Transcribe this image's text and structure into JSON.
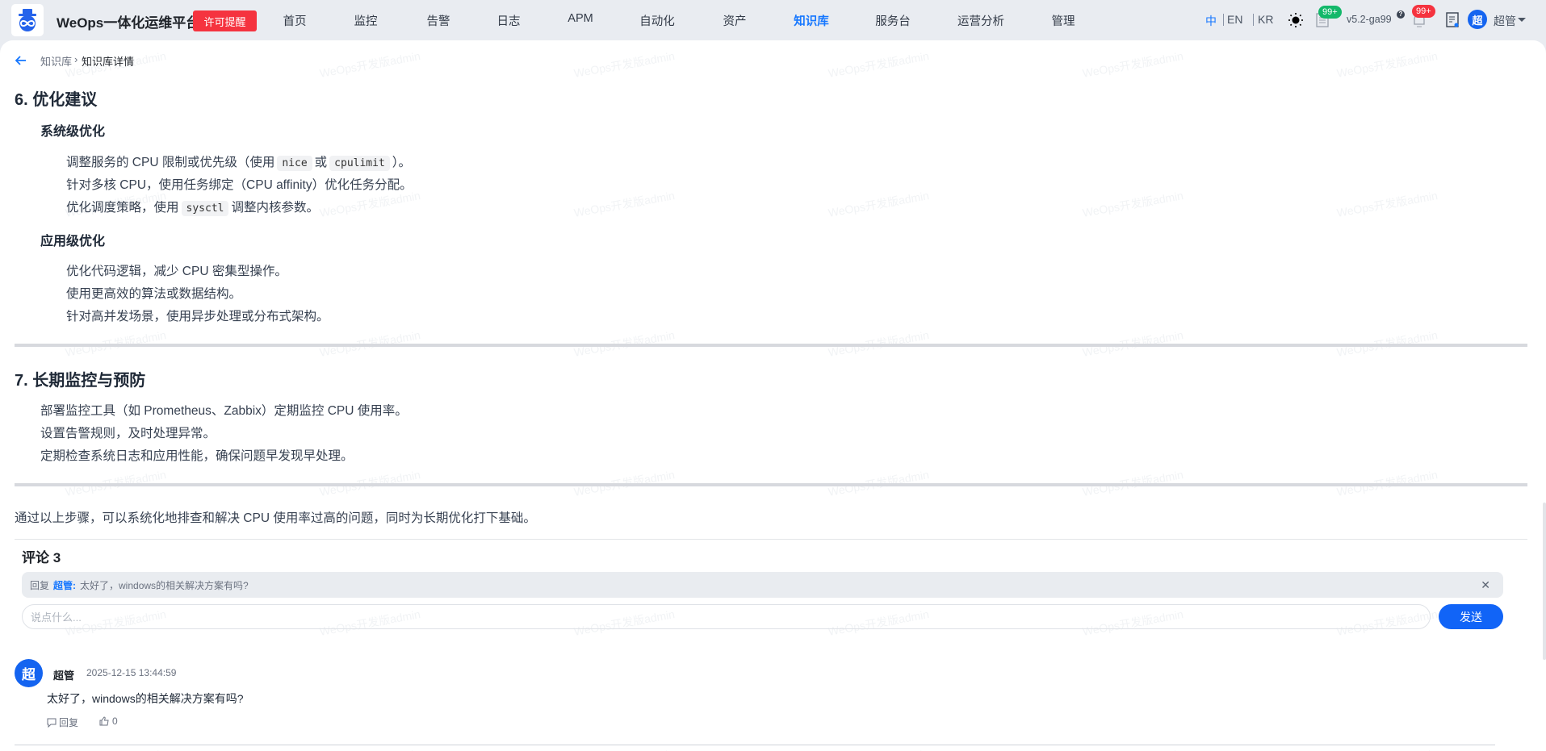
{
  "header": {
    "app_title": "WeOps一体化运维平台",
    "license_button": "许可提醒",
    "nav": [
      "首页",
      "监控",
      "告警",
      "日志",
      "APM",
      "自动化",
      "资产",
      "知识库",
      "服务台",
      "运营分析",
      "管理"
    ],
    "active_nav": "知识库",
    "languages": [
      "中",
      "EN",
      "KR"
    ],
    "doc_badge": "99+",
    "version": "v5.2-ga99",
    "help_mark": "?",
    "notification_badge": "99+",
    "user_avatar": "超",
    "user_name": "超管"
  },
  "breadcrumb": {
    "parent": "知识库",
    "sep": "›",
    "current": "知识库详情"
  },
  "article": {
    "section6": {
      "title": "6. 优化建议",
      "sub1": "系统级优化",
      "sub1_items": [
        {
          "a": "调整服务的 CPU 限制或优先级（使用",
          "code1": "nice",
          "b": "或",
          "code2": "cpulimit",
          "c": "）。"
        },
        "针对多核 CPU，使用任务绑定（CPU affinity）优化任务分配。",
        {
          "a": "优化调度策略，使用",
          "code1": "sysctl",
          "b": "调整内核参数。"
        }
      ],
      "sub2": "应用级优化",
      "sub2_items": [
        "优化代码逻辑，减少 CPU 密集型操作。",
        "使用更高效的算法或数据结构。",
        "针对高并发场景，使用异步处理或分布式架构。"
      ]
    },
    "section7": {
      "title": "7. 长期监控与预防",
      "items": [
        "部署监控工具（如 Prometheus、Zabbix）定期监控 CPU 使用率。",
        "设置告警规则，及时处理异常。",
        "定期检查系统日志和应用性能，确保问题早发现早处理。"
      ]
    },
    "conclusion": "通过以上步骤，可以系统化地排查和解决 CPU 使用率过高的问题，同时为长期优化打下基础。"
  },
  "comments": {
    "title": "评论 3",
    "reply_prefix": "回复",
    "reply_user": "超管:",
    "reply_text": "太好了，windows的相关解决方案有吗?",
    "close": "✕",
    "input_placeholder": "说点什么...",
    "send_label": "发送",
    "items": [
      {
        "avatar": "超",
        "user": "超管",
        "time": "2025-12-15 13:44:59",
        "text": "太好了，windows的相关解决方案有吗?",
        "reply_label": "回复",
        "likes": "0"
      }
    ]
  },
  "watermark": "WeOps开发版admin",
  "colors": {
    "accent": "#1677ff",
    "license": "#f5333f",
    "badge_green": "#13b86a",
    "badge_red": "#f5333f"
  }
}
